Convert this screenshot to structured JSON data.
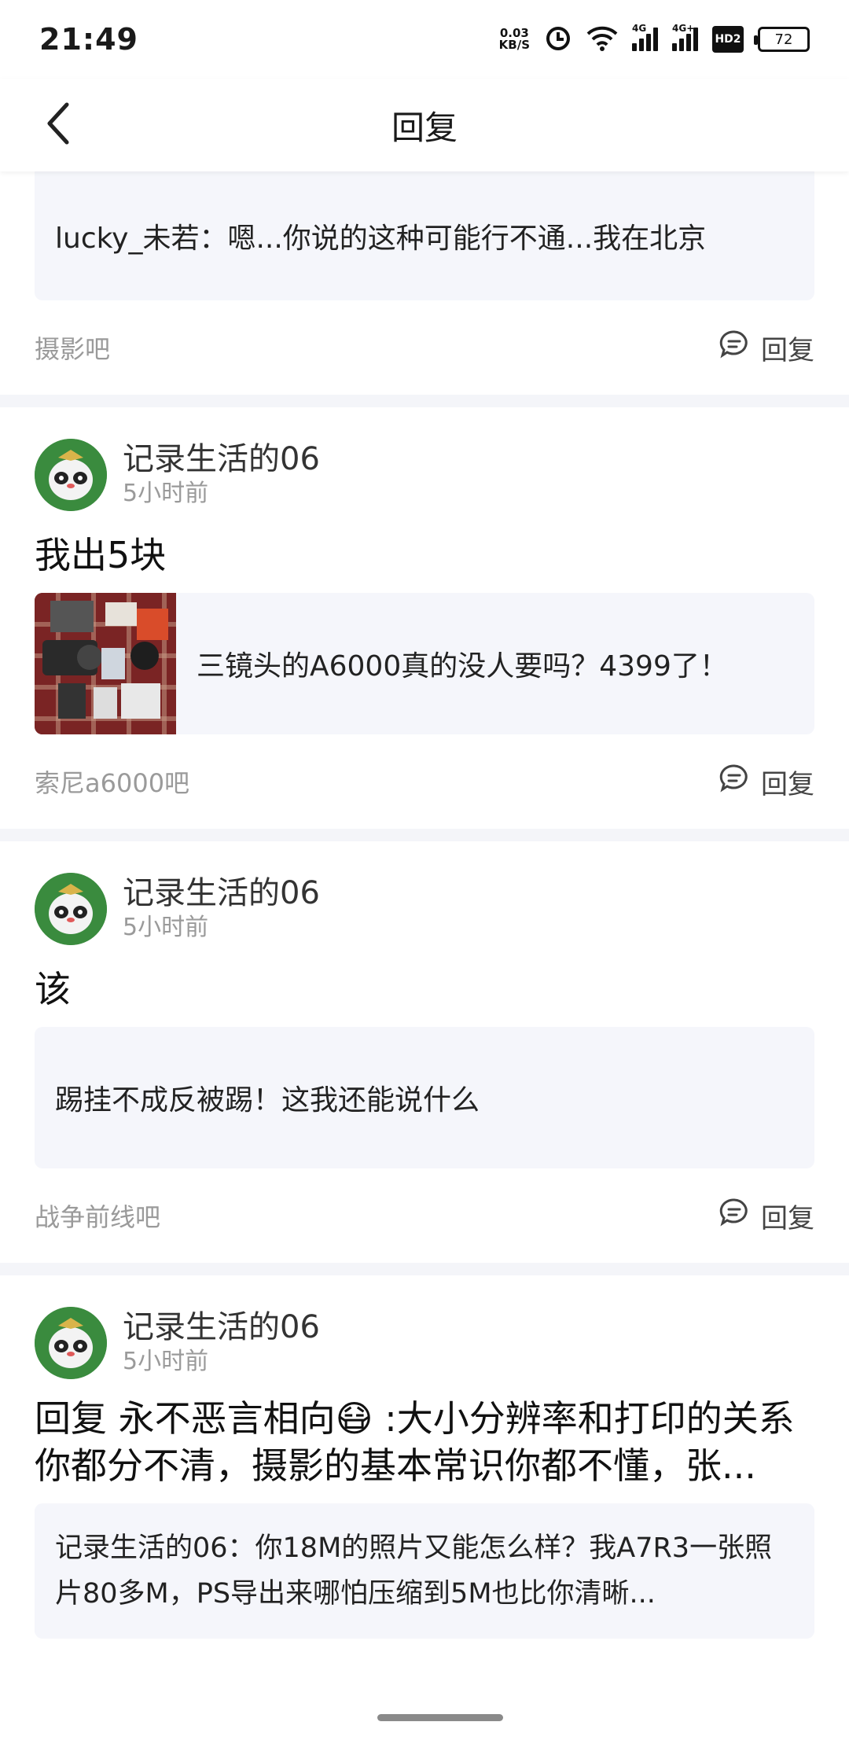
{
  "status_bar": {
    "time": "21:49",
    "net_speed_value": "0.03",
    "net_speed_unit": "KB/S",
    "signal1_label": "4G",
    "signal2_label": "4G+",
    "hd_label": "HD2",
    "battery": "72"
  },
  "header": {
    "back_icon": "chevron-left-icon",
    "title": "回复"
  },
  "posts": [
    {
      "quote": "lucky_未若：嗯...你说的这种可能行不通...我在北京",
      "forum": "摄影吧",
      "reply_label": "回复"
    },
    {
      "username": "记录生活的06",
      "time": "5小时前",
      "text": "我出5块",
      "quote": "三镜头的A6000真的没人要吗？4399了！",
      "forum": "索尼a6000吧",
      "reply_label": "回复"
    },
    {
      "username": "记录生活的06",
      "time": "5小时前",
      "text": "该",
      "quote": "踢挂不成反被踢！这我还能说什么",
      "forum": "战争前线吧",
      "reply_label": "回复"
    },
    {
      "username": "记录生活的06",
      "time": "5小时前",
      "text": "回复 永不恶言相向😷 :大小分辨率和打印的关系你都分不清，摄影的基本常识你都不懂，张...",
      "quote": "记录生活的06：你18M的照片又能怎么样？我A7R3一张照片80多M，PS导出来哪怕压缩到5M也比你清晰..."
    }
  ],
  "colors": {
    "quote_bg": "#f5f6fb",
    "divider": "#f4f5f9",
    "muted_text": "#9a9a9a"
  }
}
